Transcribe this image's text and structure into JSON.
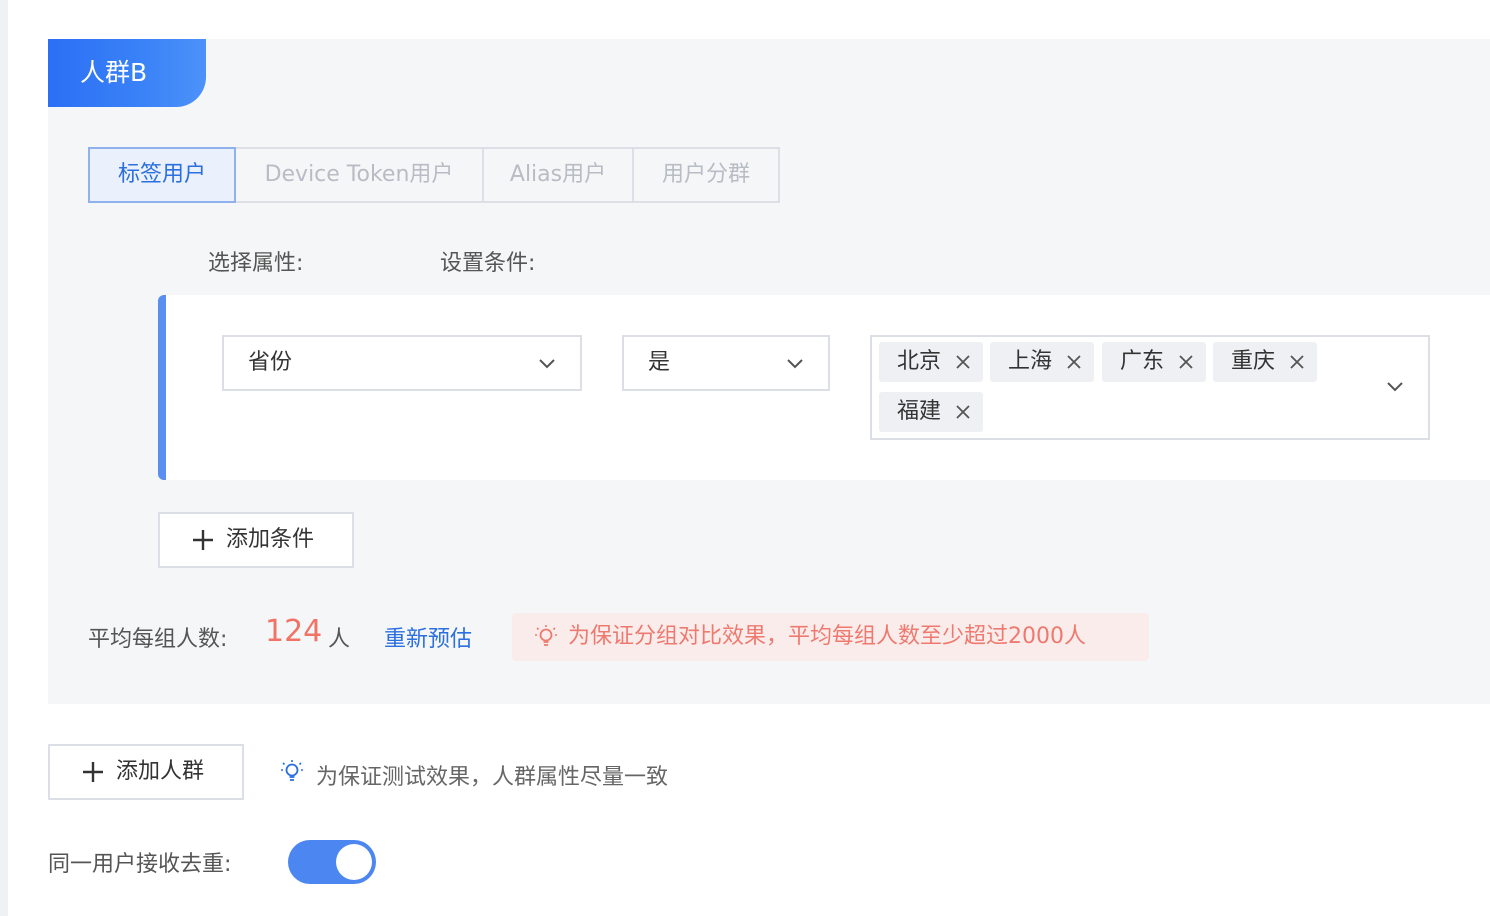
{
  "group": {
    "title": "人群B"
  },
  "tabs": [
    {
      "label": "标签用户",
      "active": true
    },
    {
      "label": "Device Token用户",
      "active": false
    },
    {
      "label": "Alias用户",
      "active": false
    },
    {
      "label": "用户分群",
      "active": false
    }
  ],
  "labels": {
    "attribute": "选择属性:",
    "condition": "设置条件:"
  },
  "condition": {
    "attribute": "省份",
    "operator": "是",
    "values": [
      "北京",
      "上海",
      "广东",
      "重庆",
      "福建"
    ]
  },
  "add_condition_label": "添加条件",
  "estimate": {
    "label": "平均每组人数:",
    "count": "124",
    "unit": "人",
    "re_estimate": "重新预估",
    "warning": "为保证分组对比效果，平均每组人数至少超过2000人"
  },
  "add_group_label": "添加人群",
  "hint": "为保证测试效果，人群属性尽量一致",
  "dedup": {
    "label": "同一用户接收去重:",
    "enabled": true
  },
  "colors": {
    "primary": "#2c6fde",
    "accent_bar": "#5a8ef0",
    "warning": "#ee7a6f",
    "toggle_on": "#4c86f1"
  },
  "icons": {
    "chevron": "chevron-down-icon",
    "remove": "close-icon",
    "add": "plus-icon",
    "tip": "lightbulb-icon"
  }
}
